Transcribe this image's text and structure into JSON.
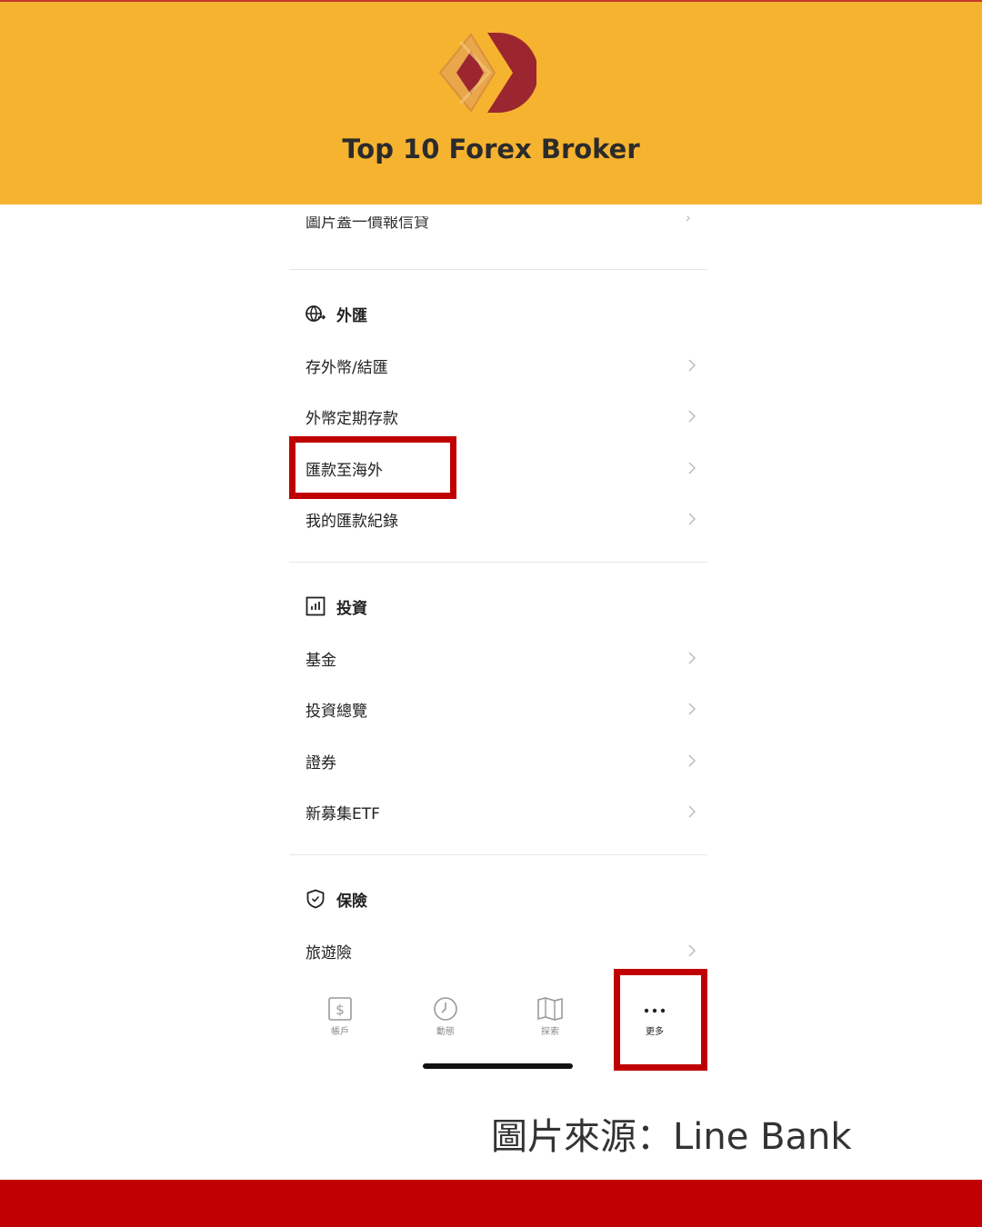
{
  "header": {
    "brand_title": "Top 10 Forex Broker",
    "background_color": "#F6B32F",
    "logo_icon": "diamond-d-logo"
  },
  "menu": {
    "cutoff_item_label": "圖片蓋一價報信貸",
    "sections": [
      {
        "title": "外匯",
        "icon": "globe-exchange-icon",
        "items": [
          {
            "label": "存外幣/結匯"
          },
          {
            "label": "外幣定期存款"
          },
          {
            "label": "匯款至海外"
          },
          {
            "label": "我的匯款紀錄"
          }
        ]
      },
      {
        "title": "投資",
        "icon": "chart-box-icon",
        "items": [
          {
            "label": "基金"
          },
          {
            "label": "投資總覽"
          },
          {
            "label": "證券"
          },
          {
            "label": "新募集ETF"
          }
        ]
      },
      {
        "title": "保險",
        "icon": "shield-check-icon",
        "items": [
          {
            "label": "旅遊險"
          }
        ]
      }
    ]
  },
  "tabbar": {
    "items": [
      {
        "label": "帳戶",
        "icon": "dollar-card-icon"
      },
      {
        "label": "動態",
        "icon": "clock-icon"
      },
      {
        "label": "探索",
        "icon": "map-icon"
      },
      {
        "label": "更多",
        "icon": "more-dots-icon",
        "active": true
      }
    ]
  },
  "highlight_color": "#C00000",
  "source_caption": "圖片來源：Line Bank",
  "footer_color": "#C00000"
}
